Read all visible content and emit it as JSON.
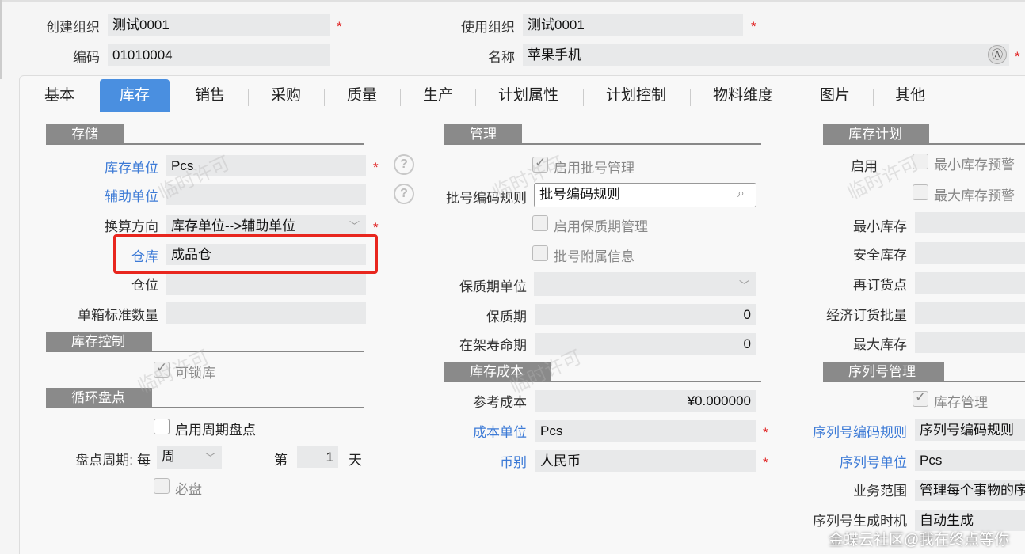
{
  "header": {
    "create_org_label": "创建组织",
    "create_org_value": "测试0001",
    "use_org_label": "使用组织",
    "use_org_value": "测试0001",
    "code_label": "编码",
    "code_value": "01010004",
    "name_label": "名称",
    "name_value": "苹果手机",
    "required_mark": "*"
  },
  "tabs": [
    "基本",
    "库存",
    "销售",
    "采购",
    "质量",
    "生产",
    "计划属性",
    "计划控制",
    "物料维度",
    "图片",
    "其他"
  ],
  "active_tab": "库存",
  "storage": {
    "title": "存储",
    "unit_label": "库存单位",
    "unit_value": "Pcs",
    "aux_unit_label": "辅助单位",
    "aux_unit_value": "",
    "conv_label": "换算方向",
    "conv_value": "库存单位-->辅助单位",
    "warehouse_label": "仓库",
    "warehouse_value": "成品仓",
    "location_label": "仓位",
    "location_value": "",
    "box_qty_label": "单箱标准数量",
    "box_qty_value": ""
  },
  "stock_control": {
    "title": "库存控制",
    "lockable_label": "可锁库",
    "lockable_checked": true
  },
  "cycle_count": {
    "title": "循环盘点",
    "enable_label": "启用周期盘点",
    "enable_checked": false,
    "period_label": "盘点周期:",
    "every_label": "每",
    "period_value": "周",
    "nth_label": "第",
    "nth_value": "1",
    "day_label": "天",
    "must_label": "必盘",
    "must_checked": false
  },
  "management": {
    "title": "管理",
    "batch_enable_label": "启用批号管理",
    "batch_enable_checked": true,
    "batch_rule_label": "批号编码规则",
    "batch_rule_value": "批号编码规则",
    "shelf_enable_label": "启用保质期管理",
    "shelf_enable_checked": false,
    "batch_attach_label": "批号附属信息",
    "batch_attach_checked": false,
    "shelf_unit_label": "保质期单位",
    "shelf_unit_value": "",
    "shelf_label": "保质期",
    "shelf_value": "0",
    "shelf_life_label": "在架寿命期",
    "shelf_life_value": "0"
  },
  "stock_cost": {
    "title": "库存成本",
    "ref_cost_label": "参考成本",
    "ref_cost_value": "¥0.000000",
    "cost_unit_label": "成本单位",
    "cost_unit_value": "Pcs",
    "currency_label": "币别",
    "currency_value": "人民币"
  },
  "stock_plan": {
    "title": "库存计划",
    "enable_label": "启用",
    "min_alert_label": "最小库存预警",
    "max_alert_label": "最大库存预警",
    "min_stock_label": "最小库存",
    "safety_stock_label": "安全库存",
    "reorder_label": "再订货点",
    "eoq_label": "经济订货批量",
    "max_stock_label": "最大库存"
  },
  "serial": {
    "title": "序列号管理",
    "stock_mgmt_label": "库存管理",
    "stock_mgmt_checked": true,
    "rule_label": "序列号编码规则",
    "rule_value": "序列号编码规则",
    "unit_label": "序列号单位",
    "unit_value": "Pcs",
    "scope_label": "业务范围",
    "scope_value": "管理每个事物的序",
    "gen_label": "序列号生成时机",
    "gen_value": "自动生成"
  },
  "watermarks": [
    "临时许可",
    "临时许可",
    "临时许可",
    "临时许可",
    "临时许可"
  ],
  "footer_text": "金蝶云社区@我在终点等你",
  "colors": {
    "accent": "#4a8fe0",
    "link": "#3c7ad6",
    "required": "#e02020",
    "highlight": "#e8261e"
  }
}
